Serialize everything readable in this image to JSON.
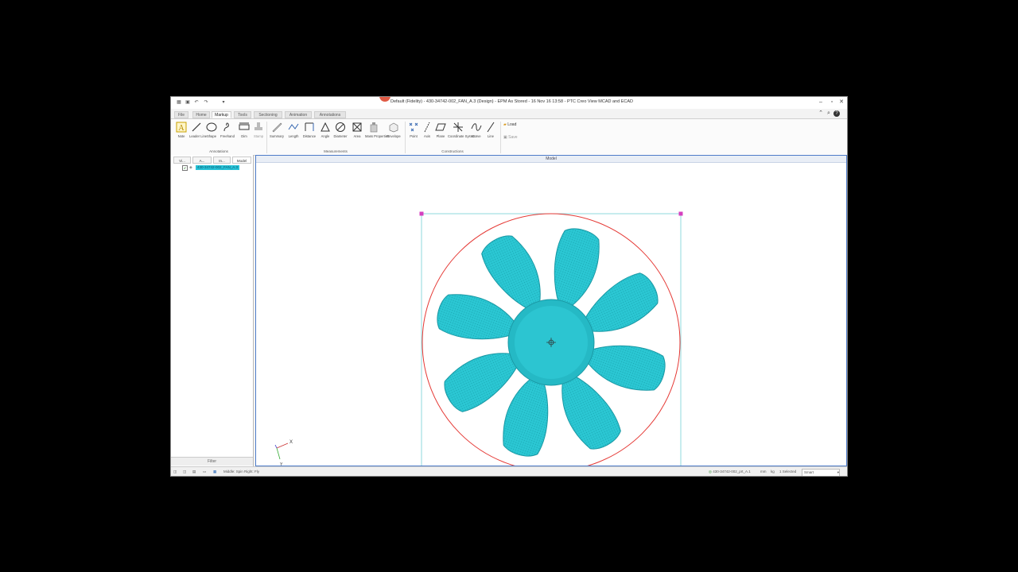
{
  "window": {
    "title": "Default (Fidelity) - 430-34742-002_FAN_A.3 (Design) - EPM As Stored - 16 Nov 16 13:58 - PTC Creo View MCAD and ECAD"
  },
  "tabs": [
    {
      "label": "File",
      "active": false
    },
    {
      "label": "Home",
      "active": false
    },
    {
      "label": "Markup",
      "active": true
    },
    {
      "label": "Tools",
      "active": false
    },
    {
      "label": "Sectioning",
      "active": false
    },
    {
      "label": "Animation",
      "active": false
    },
    {
      "label": "Annotations",
      "active": false
    }
  ],
  "ribbon": {
    "annotations": [
      {
        "label": "Note",
        "icon": "note-icon"
      },
      {
        "label": "Leader Line",
        "icon": "leader-line-icon"
      },
      {
        "label": "Shape",
        "icon": "shape-icon"
      },
      {
        "label": "Freehand",
        "icon": "freehand-icon"
      },
      {
        "label": "Dim",
        "icon": "dim-icon"
      },
      {
        "label": "Stamp",
        "icon": "stamp-icon"
      }
    ],
    "measurements": [
      {
        "label": "Summary",
        "icon": "summary-icon"
      },
      {
        "label": "Length",
        "icon": "length-icon"
      },
      {
        "label": "Distance",
        "icon": "distance-icon"
      },
      {
        "label": "Angle",
        "icon": "angle-icon"
      },
      {
        "label": "Diameter",
        "icon": "diameter-icon"
      },
      {
        "label": "Area",
        "icon": "area-icon"
      },
      {
        "label": "Mass Properties",
        "icon": "mass-properties-icon"
      },
      {
        "label": "Envelope",
        "icon": "envelope-icon"
      }
    ],
    "constructions": [
      {
        "label": "Point",
        "icon": "point-icon"
      },
      {
        "label": "Axis",
        "icon": "axis-icon"
      },
      {
        "label": "Plane",
        "icon": "plane-icon"
      },
      {
        "label": "Coordinate System",
        "icon": "coordinate-system-icon"
      },
      {
        "label": "Curve",
        "icon": "curve-icon"
      },
      {
        "label": "Line",
        "icon": "line-icon"
      }
    ],
    "file_actions": {
      "load": "Load",
      "save": "Save"
    },
    "groups": {
      "annotations": "Annotations",
      "measurements": "Measurements",
      "constructions": "Constructions"
    }
  },
  "tree": {
    "tabs": [
      "Vi...",
      "A...",
      "In...",
      "Model"
    ],
    "item": "430-34742-002_FAN_A.3",
    "filter": "Filter"
  },
  "viewport": {
    "header": "Model"
  },
  "status": {
    "left": "Middle: Spin   Right: Fly",
    "model": "430-34742-002_prt_A.1",
    "units_length": "mm",
    "units_mass": "kg",
    "selected": "1 Selected",
    "mode": "Smart"
  },
  "colors": {
    "fan": "#2bc7d3",
    "circle": "#e53935",
    "handle": "#d43fbf",
    "accent": "#4e7cc9"
  }
}
